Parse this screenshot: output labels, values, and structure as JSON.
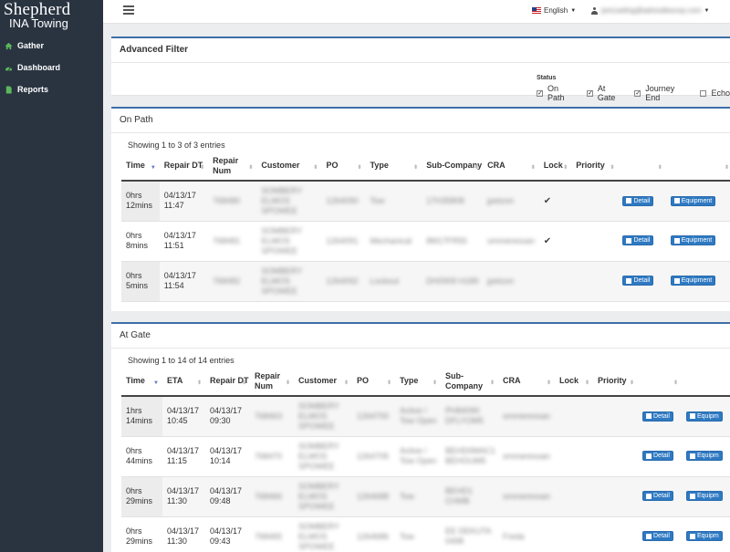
{
  "brand": {
    "line1": "Shepherd",
    "line2": "INA Towing"
  },
  "nav": [
    {
      "label": "Gather",
      "icon": "home-icon"
    },
    {
      "label": "Dashboard",
      "icon": "dashboard-icon"
    },
    {
      "label": "Reports",
      "icon": "report-icon"
    }
  ],
  "header": {
    "language": "English",
    "user_email": "jsmcseling@adresdieurop.com"
  },
  "advanced_filter": {
    "title": "Advanced Filter",
    "status_label": "Status",
    "options": [
      {
        "label": "On Path",
        "checked": true
      },
      {
        "label": "At Gate",
        "checked": true
      },
      {
        "label": "Journey End",
        "checked": true
      },
      {
        "label": "Echo",
        "checked": false
      }
    ]
  },
  "on_path": {
    "title": "On Path",
    "entries": "Showing 1 to 3 of 3 entries",
    "columns": [
      "Time",
      "Repair DT",
      "Repair Num",
      "Customer",
      "PO",
      "Type",
      "Sub-Company",
      "CRA",
      "Lock",
      "Priority",
      "",
      ""
    ],
    "rows": [
      {
        "time": "0hrs 12mins",
        "repair_dt": "04/13/17 11:47",
        "repair_num": "768480",
        "customer": "SOMBERY ELMOS SPOWEE",
        "po": "1264090",
        "type": "Tow",
        "sub_company": "17H35808",
        "cra": "jpetzon",
        "lock": true,
        "detail": "Detail",
        "equipment": "Equipment"
      },
      {
        "time": "0hrs 8mins",
        "repair_dt": "04/13/17 11:51",
        "repair_num": "768481",
        "customer": "SOMBERY ELMOS SPOWEE",
        "po": "1264091",
        "type": "Mechanical",
        "sub_company": "8M17FR55",
        "cra": "ommeressan",
        "lock": true,
        "detail": "Detail",
        "equipment": "Equipment"
      },
      {
        "time": "0hrs 5mins",
        "repair_dt": "04/13/17 11:54",
        "repair_num": "768482",
        "customer": "SOMBERY ELMOS SPOWEE",
        "po": "1264092",
        "type": "Lockout",
        "sub_company": "DH0909 H189",
        "cra": "jpetzon",
        "lock": false,
        "detail": "Detail",
        "equipment": "Equipment"
      }
    ]
  },
  "at_gate": {
    "title": "At Gate",
    "entries": "Showing 1 to 14 of 14 entries",
    "columns": [
      "Time",
      "ETA",
      "Repair DT",
      "Repair Num",
      "Customer",
      "PO",
      "Type",
      "Sub-Company",
      "CRA",
      "Lock",
      "Priority",
      "",
      ""
    ],
    "rows": [
      {
        "time": "1hrs 14mins",
        "eta": "04/13/17 10:45",
        "repair_dt": "04/13/17 09:30",
        "repair_num": "768463",
        "customer": "SOMBERY ELMOS SPOWEE",
        "po": "1264700",
        "type": "Active / Tow Open",
        "sub_company": "PH84090 DFLYOM5",
        "cra": "ommeressan",
        "detail": "Detail",
        "equipment": "Equipm"
      },
      {
        "time": "0hrs 44mins",
        "eta": "04/13/17 11:15",
        "repair_dt": "04/13/17 10:14",
        "repair_num": "768470",
        "customer": "SOMBERY ELMOS SPOWEE",
        "po": "1264705",
        "type": "Active / Tow Open",
        "sub_company": "BEHD0MAC1 BEHOUM5",
        "cra": "ommeressan",
        "detail": "Detail",
        "equipment": "Equipm"
      },
      {
        "time": "0hrs 29mins",
        "eta": "04/13/17 11:30",
        "repair_dt": "04/13/17 09:48",
        "repair_num": "768466",
        "customer": "SOMBERY ELMOS SPOWEE",
        "po": "1264688",
        "type": "Tow",
        "sub_company": "BEHD1 CHMB",
        "cra": "ommeressan",
        "detail": "Detail",
        "equipment": "Equipm"
      },
      {
        "time": "0hrs 29mins",
        "eta": "04/13/17 11:30",
        "repair_dt": "04/13/17 09:43",
        "repair_num": "768465",
        "customer": "SOMBERY ELMOS SPOWEE",
        "po": "1264686",
        "type": "Tow",
        "sub_company": "EE DEKUTA 0498",
        "cra": "Freda",
        "detail": "Detail",
        "equipment": "Equipm"
      }
    ]
  }
}
